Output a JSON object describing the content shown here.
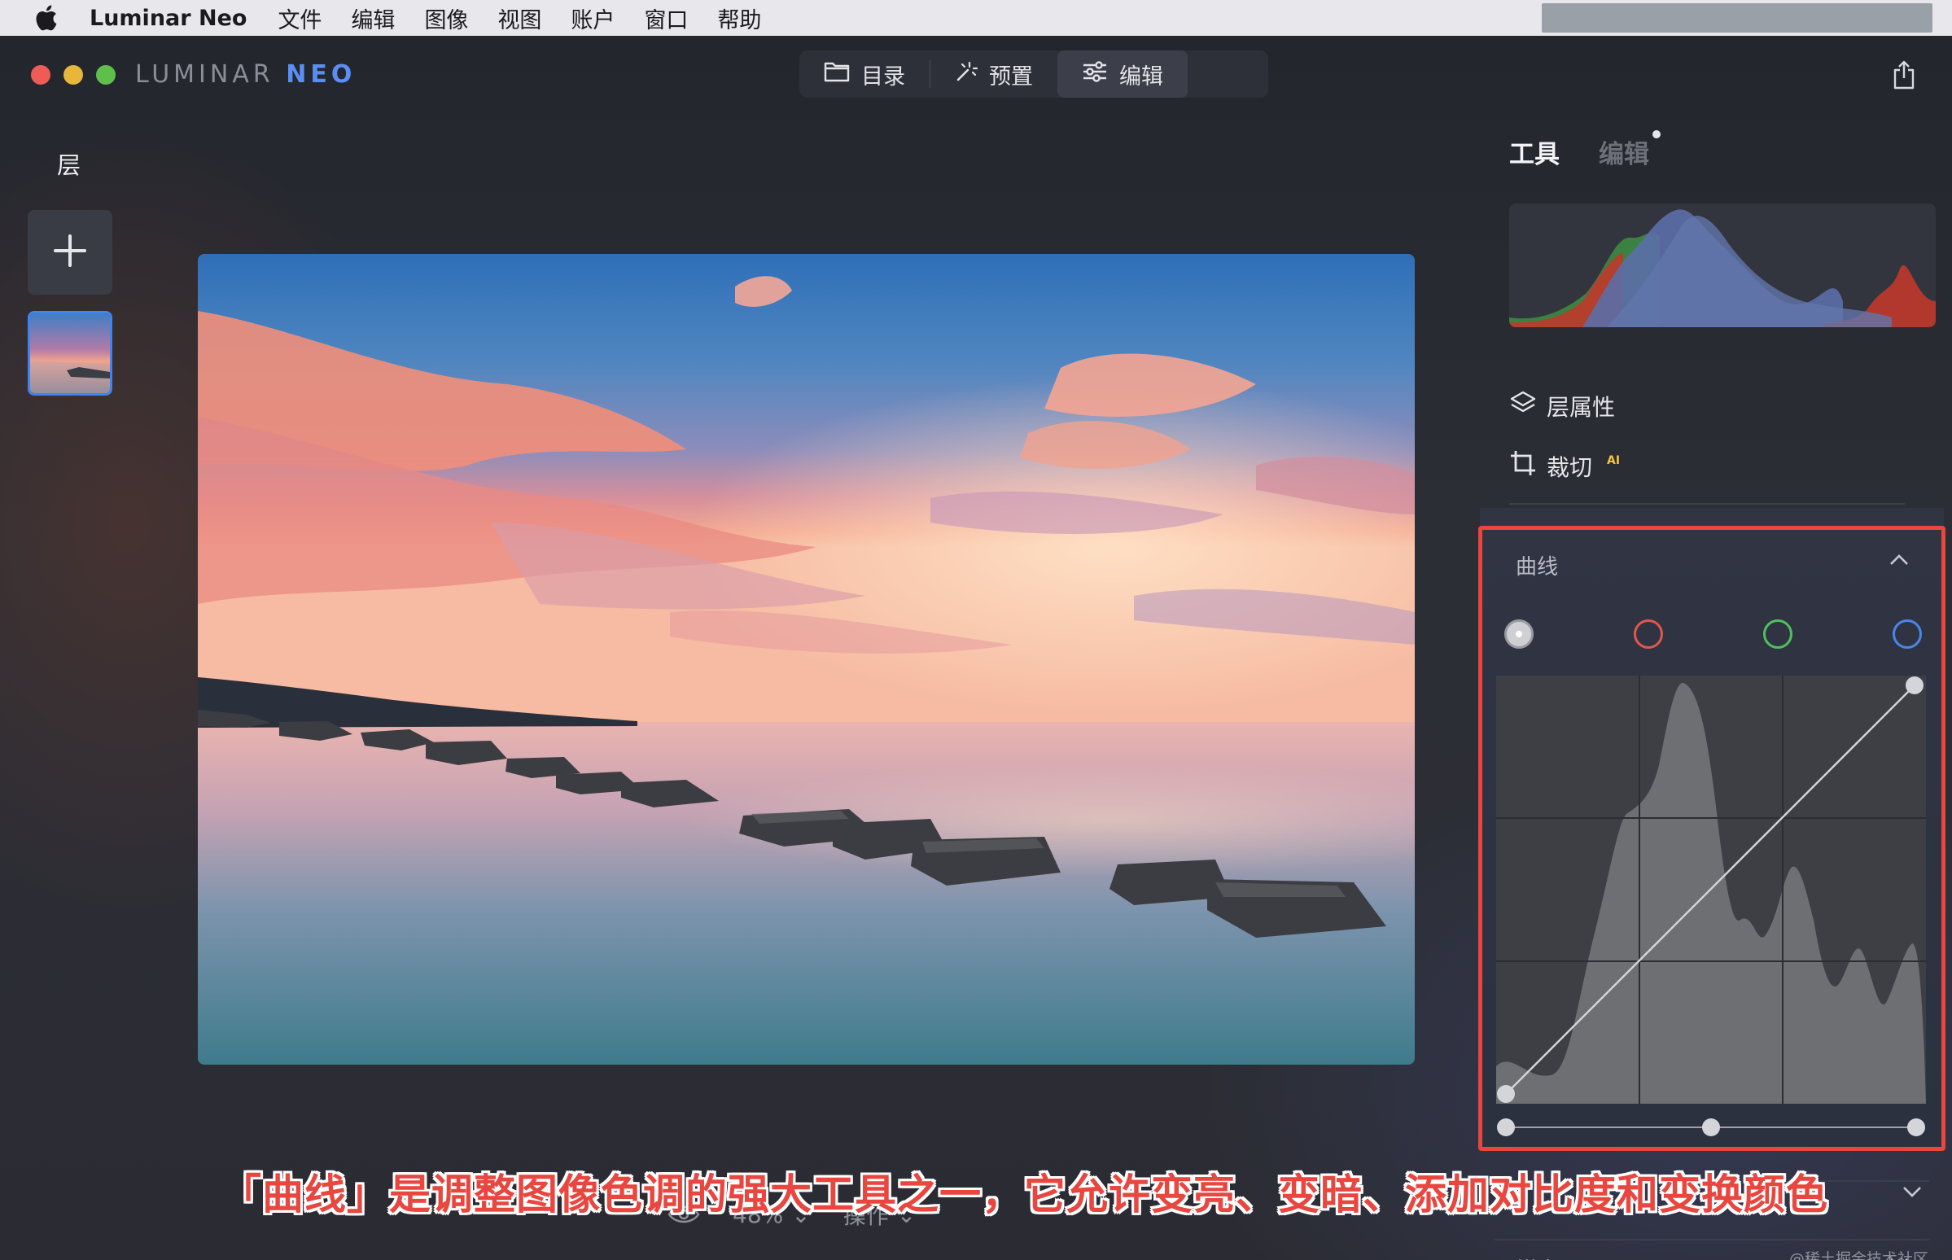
{
  "menubar": {
    "app_name": "Luminar Neo",
    "items": [
      "文件",
      "编辑",
      "图像",
      "视图",
      "账户",
      "窗口",
      "帮助"
    ]
  },
  "window": {
    "logo_text": "LUMINAR",
    "logo_accent": "NEO",
    "tabs": [
      {
        "label": "目录",
        "icon": "folder-icon"
      },
      {
        "label": "预置",
        "icon": "magic-wand-icon"
      },
      {
        "label": "编辑",
        "icon": "sliders-icon"
      }
    ],
    "active_tab": "编辑"
  },
  "layers": {
    "title": "层"
  },
  "bottom": {
    "zoom": "48%",
    "actions_label": "操作"
  },
  "right_panel": {
    "tabs": {
      "tools": "工具",
      "edits": "编辑"
    },
    "layer_properties": "层属性",
    "crop": "裁切",
    "crop_badge": "AI",
    "curves": {
      "title": "曲线",
      "channels": [
        "rgb",
        "red",
        "green",
        "blue"
      ],
      "channel_colors": {
        "rgb": "#cfd0d4",
        "red": "#e0584a",
        "green": "#4ec05c",
        "blue": "#4a86e8"
      },
      "slider_points": [
        0,
        0.5,
        1
      ]
    },
    "sharpness": "锐度"
  },
  "colors": {
    "accent": "#3f84f0",
    "highlight": "#e8463f"
  },
  "subtitle": "「曲线」是调整图像色调的强大工具之一，它允许变亮、变暗、添加对比度和变换颜色",
  "watermark": "@稀土掘金技术社区"
}
